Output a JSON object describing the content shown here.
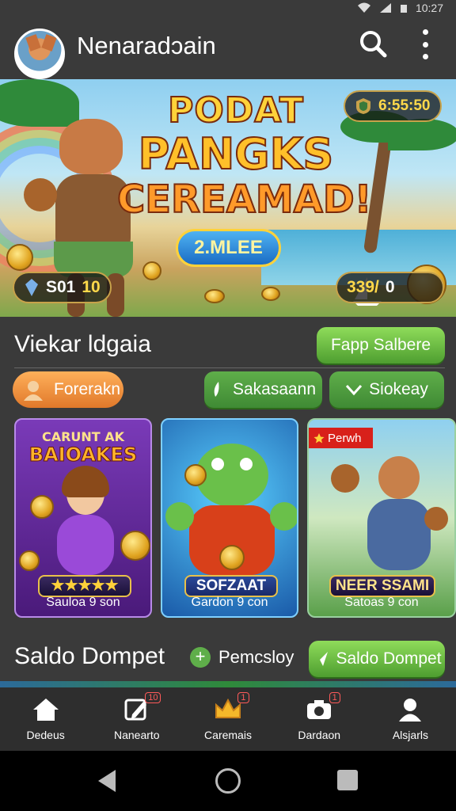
{
  "status_bar": {
    "time": "10:27"
  },
  "header": {
    "title": "Nenaradɔain"
  },
  "banner": {
    "title_line1": "PODAT",
    "title_line2": "PANGKS",
    "title_line3": "CEREAMAD!",
    "pill_label": "2.MLEE",
    "timer": "6:55:50",
    "left_chip_label": "S01",
    "left_chip_value": "10",
    "right_chip_value": "339/",
    "right_chip_extra": "0"
  },
  "section1": {
    "title": "Viekar ldgaia",
    "action_button": "Fapp Salbere"
  },
  "filters": {
    "chip_orange": "Forerakn",
    "chip_green1": "Sakasaann",
    "chip_green2": "Siokeay"
  },
  "cards": [
    {
      "top_line1": "CARUNT AK",
      "top_line2": "BAIOAKES",
      "plaque": "★★★★★",
      "subtitle": "Sauloa 9 son"
    },
    {
      "plaque": "SOFZAAT",
      "subtitle": "Gardon 9 con"
    },
    {
      "ribbon": "Perwh",
      "plaque": "NEER SSAMI",
      "subtitle": "Satoas 9 con"
    }
  ],
  "section2": {
    "title": "Saldo Dompet",
    "link": "Pemcsloy",
    "action_button": "Saldo Dompet"
  },
  "tabs": [
    {
      "label": "Dedeus",
      "icon": "home-icon"
    },
    {
      "label": "Nanearto",
      "icon": "edit-icon",
      "badge": "10"
    },
    {
      "label": "Caremais",
      "icon": "crown-icon",
      "badge": "1"
    },
    {
      "label": "Dardaon",
      "icon": "camera-icon",
      "badge": "1"
    },
    {
      "label": "Alsjarls",
      "icon": "user-icon"
    }
  ]
}
